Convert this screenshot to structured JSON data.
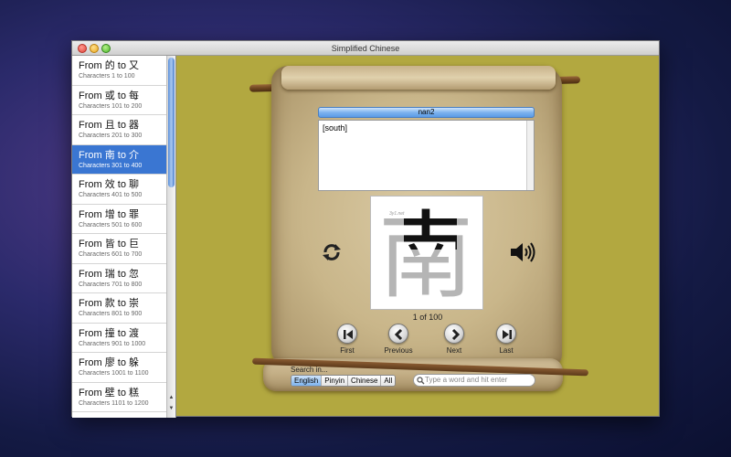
{
  "window": {
    "title": "Simplified Chinese"
  },
  "sidebar": {
    "items": [
      {
        "title": "From 的 to 又",
        "subtitle": "Characters 1 to 100"
      },
      {
        "title": "From 或 to 每",
        "subtitle": "Characters 101 to 200"
      },
      {
        "title": "From 且 to 器",
        "subtitle": "Characters 201 to 300"
      },
      {
        "title": "From 南 to 介",
        "subtitle": "Characters 301 to 400",
        "selected": true
      },
      {
        "title": "From 效 to 聊",
        "subtitle": "Characters 401 to 500"
      },
      {
        "title": "From 增 to 罪",
        "subtitle": "Characters 501 to 600"
      },
      {
        "title": "From 皆 to 巨",
        "subtitle": "Characters 601 to 700"
      },
      {
        "title": "From 瑞 to 忽",
        "subtitle": "Characters 701 to 800"
      },
      {
        "title": "From 款 to 崇",
        "subtitle": "Characters 801 to 900"
      },
      {
        "title": "From 撞 to 渡",
        "subtitle": "Characters 901 to 1000"
      },
      {
        "title": "From 廖 to 躲",
        "subtitle": "Characters 1001 to 1100"
      },
      {
        "title": "From 壁 to 糕",
        "subtitle": "Characters 1101 to 1200"
      }
    ]
  },
  "card": {
    "pinyin": "nan2",
    "definition": "[south]",
    "character": "南",
    "logo": "3y1.net",
    "counter": "1 of 100"
  },
  "nav": {
    "first": "First",
    "previous": "Previous",
    "next": "Next",
    "last": "Last"
  },
  "search": {
    "label": "Search in...",
    "options": [
      "English",
      "Pinyin",
      "Chinese",
      "All"
    ],
    "active": "English",
    "placeholder": "Type a word and hit enter"
  },
  "icons": {
    "refresh": "refresh-icon",
    "speaker": "speaker-icon"
  },
  "colors": {
    "background": "#b2a840",
    "selection": "#3a76d2",
    "pinyin_bar": "#7db3ee"
  }
}
